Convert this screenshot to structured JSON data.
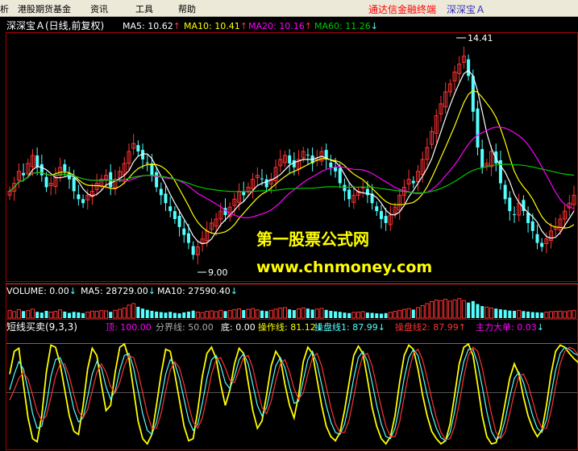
{
  "menubar": {
    "items": [
      "析",
      "港股期货基金",
      "资讯",
      "工具",
      "帮助"
    ],
    "app_title": "通达信金融终端",
    "security_title": "深深宝Ａ"
  },
  "colors": {
    "up": "#ff3232",
    "down": "#54ffff",
    "ma5": "#ffffff",
    "ma10": "#ffff00",
    "ma20": "#ff00ff",
    "ma60": "#00c800",
    "panel_border": "#aa0000",
    "title_red": "#ff0000",
    "title_blue": "#3030c0",
    "watermark": "#ffff00"
  },
  "chart_data": [
    {
      "type": "candlestick",
      "title": "深深宝Ａ(日线,前复权)",
      "legend": [
        {
          "label": "MA5: 10.62",
          "arrow": "↑",
          "color": "#ffffff"
        },
        {
          "label": "MA10: 10.41",
          "arrow": "↑",
          "color": "#ffff00"
        },
        {
          "label": "MA20: 10.16",
          "arrow": "↑",
          "color": "#ff00ff"
        },
        {
          "label": "MA60: 11.26",
          "arrow": "↓",
          "color": "#00c800"
        }
      ],
      "annotations": [
        {
          "text": "14.41",
          "kind": "high"
        },
        {
          "text": "9.00",
          "kind": "low"
        }
      ],
      "ylim": [
        8.7,
        14.8
      ],
      "closes": [
        10.9,
        11.1,
        11.4,
        11.3,
        11.6,
        11.8,
        11.5,
        11.3,
        11.0,
        11.1,
        11.3,
        11.5,
        11.4,
        11.2,
        10.9,
        10.7,
        10.6,
        10.8,
        10.9,
        11.1,
        11.2,
        11.3,
        11.0,
        11.2,
        11.4,
        11.6,
        11.9,
        12.1,
        11.9,
        11.7,
        11.6,
        11.3,
        11.0,
        10.8,
        10.6,
        10.4,
        10.2,
        10.0,
        9.8,
        9.6,
        9.3,
        9.5,
        9.7,
        9.9,
        10.1,
        10.2,
        10.4,
        10.3,
        10.5,
        10.7,
        10.9,
        10.8,
        11.0,
        11.2,
        11.3,
        11.2,
        11.0,
        11.2,
        11.5,
        11.7,
        11.8,
        11.6,
        11.5,
        11.7,
        11.9,
        11.8,
        11.6,
        11.7,
        11.9,
        11.7,
        11.5,
        11.4,
        11.1,
        10.9,
        10.7,
        10.8,
        10.9,
        11.0,
        10.8,
        10.6,
        10.4,
        10.2,
        10.1,
        10.3,
        10.5,
        10.8,
        11.0,
        11.2,
        11.1,
        11.4,
        11.7,
        12.0,
        12.4,
        12.8,
        13.1,
        13.4,
        13.6,
        13.9,
        14.1,
        14.3,
        13.8,
        12.9,
        12.0,
        11.5,
        11.6,
        11.9,
        11.6,
        11.1,
        10.7,
        10.4,
        10.3,
        10.6,
        10.4,
        10.1,
        9.9,
        9.6,
        9.5,
        9.7,
        9.9,
        10.0,
        10.2,
        10.4,
        10.6,
        10.8
      ]
    },
    {
      "type": "bar",
      "title": "VOLUME: 0.00",
      "legend": [
        {
          "label": "VOLUME: 0.00",
          "arrow": "↓",
          "color": "#ffffff"
        },
        {
          "label": "MA5: 28729.00",
          "arrow": "↓",
          "color": "#ffffff"
        },
        {
          "label": "MA10: 27590.40",
          "arrow": "↓",
          "color": "#ffffff"
        }
      ],
      "values": [
        31000,
        26000,
        34000,
        28000,
        30000,
        36000,
        25000,
        22000,
        29000,
        24000,
        27000,
        33000,
        26000,
        21000,
        25000,
        23000,
        20000,
        24000,
        28000,
        27000,
        30000,
        29000,
        25000,
        31000,
        35000,
        40000,
        52000,
        58000,
        45000,
        38000,
        33000,
        29000,
        26000,
        24000,
        22000,
        25000,
        21000,
        19000,
        23000,
        26000,
        30000,
        24000,
        22000,
        27000,
        29000,
        26000,
        31000,
        28000,
        30000,
        34000,
        37000,
        32000,
        35000,
        38000,
        33000,
        30000,
        28000,
        31000,
        36000,
        40000,
        42000,
        35000,
        32000,
        37000,
        41000,
        38000,
        34000,
        36000,
        39000,
        33000,
        29000,
        27000,
        25000,
        22000,
        20000,
        23000,
        24000,
        26000,
        22000,
        21000,
        19000,
        18000,
        20000,
        23000,
        27000,
        31000,
        35000,
        38000,
        34000,
        42000,
        50000,
        58000,
        66000,
        72000,
        70000,
        75000,
        68000,
        73000,
        78000,
        70000,
        62000,
        68000,
        56000,
        48000,
        44000,
        40000,
        38000,
        35000,
        33000,
        30000,
        29000,
        31000,
        28000,
        26000,
        24000,
        23000,
        22000,
        24000,
        26000,
        27000,
        28000,
        26000,
        29000,
        31000
      ],
      "ylim": [
        0,
        90000
      ]
    },
    {
      "type": "line",
      "title": "短线买卖(9,3,3)",
      "legend": [
        {
          "label": "短线买卖(9,3,3)",
          "arrow": "",
          "color": "#ffffff"
        },
        {
          "label": "顶: 100.00",
          "arrow": "",
          "color": "#ff00ff"
        },
        {
          "label": "分界线: 50.00",
          "arrow": "",
          "color": "#aaaaaa"
        },
        {
          "label": "底: 0.00",
          "arrow": "",
          "color": "#ffffff"
        },
        {
          "label": "操作线: 81.12",
          "arrow": "↓",
          "color": "#ffff00"
        },
        {
          "label": "操盘线1: 87.99",
          "arrow": "↓",
          "color": "#54ffff"
        },
        {
          "label": "操盘线2: 87.99",
          "arrow": "↑",
          "color": "#ff3232"
        },
        {
          "label": "主力大单: 0.03",
          "arrow": "↓",
          "color": "#ff00ff"
        }
      ],
      "levels": {
        "top": 100,
        "mid": 50,
        "bottom": 0
      },
      "ylim": [
        0,
        110
      ],
      "series": [
        {
          "name": "操作线",
          "color": "#ffff00",
          "values": [
            70,
            92,
            95,
            60,
            28,
            8,
            5,
            30,
            72,
            98,
            96,
            80,
            55,
            30,
            15,
            12,
            40,
            75,
            95,
            88,
            60,
            35,
            40,
            72,
            96,
            99,
            85,
            55,
            25,
            8,
            3,
            12,
            40,
            70,
            94,
            92,
            70,
            45,
            20,
            6,
            8,
            35,
            68,
            90,
            96,
            85,
            60,
            40,
            55,
            80,
            95,
            90,
            62,
            35,
            18,
            25,
            50,
            78,
            92,
            85,
            60,
            40,
            28,
            50,
            82,
            96,
            90,
            65,
            40,
            20,
            10,
            6,
            14,
            35,
            62,
            88,
            97,
            90,
            65,
            38,
            20,
            8,
            3,
            10,
            30,
            62,
            88,
            98,
            94,
            75,
            50,
            30,
            15,
            8,
            3,
            6,
            22,
            50,
            80,
            96,
            99,
            88,
            60,
            30,
            10,
            3,
            4,
            18,
            42,
            66,
            80,
            70,
            48,
            30,
            18,
            10,
            16,
            40,
            70,
            92,
            98,
            96,
            90,
            85,
            81
          ]
        },
        {
          "name": "操盘线1",
          "color": "#54ffff",
          "values": [
            55,
            70,
            82,
            75,
            55,
            32,
            18,
            20,
            40,
            68,
            84,
            86,
            75,
            56,
            36,
            24,
            28,
            48,
            70,
            82,
            76,
            58,
            46,
            54,
            74,
            88,
            90,
            76,
            54,
            32,
            16,
            12,
            24,
            46,
            70,
            84,
            80,
            66,
            46,
            26,
            16,
            22,
            42,
            66,
            84,
            88,
            78,
            62,
            56,
            68,
            84,
            90,
            80,
            60,
            40,
            30,
            38,
            58,
            78,
            86,
            76,
            58,
            42,
            44,
            64,
            84,
            92,
            80,
            60,
            40,
            24,
            14,
            12,
            22,
            42,
            66,
            86,
            92,
            82,
            62,
            40,
            22,
            10,
            8,
            18,
            40,
            66,
            86,
            94,
            88,
            70,
            50,
            32,
            18,
            9,
            6,
            14,
            34,
            60,
            82,
            94,
            94,
            80,
            58,
            34,
            15,
            7,
            10,
            26,
            48,
            66,
            72,
            62,
            46,
            30,
            18,
            14,
            26,
            50,
            74,
            90,
            96,
            94,
            90,
            88
          ]
        },
        {
          "name": "操盘线2",
          "color": "#ff3232",
          "values": [
            45,
            55,
            66,
            72,
            65,
            50,
            34,
            25,
            30,
            48,
            68,
            80,
            80,
            68,
            50,
            34,
            28,
            36,
            54,
            72,
            80,
            72,
            58,
            52,
            62,
            78,
            88,
            86,
            72,
            52,
            32,
            18,
            18,
            32,
            54,
            74,
            82,
            76,
            60,
            40,
            24,
            18,
            28,
            48,
            70,
            84,
            86,
            76,
            64,
            62,
            74,
            86,
            88,
            76,
            56,
            38,
            32,
            44,
            64,
            80,
            84,
            72,
            56,
            46,
            52,
            70,
            86,
            90,
            78,
            58,
            38,
            22,
            14,
            14,
            26,
            48,
            72,
            88,
            90,
            78,
            58,
            38,
            20,
            10,
            10,
            24,
            48,
            72,
            90,
            94,
            84,
            66,
            46,
            28,
            14,
            7,
            8,
            20,
            42,
            68,
            88,
            96,
            92,
            76,
            54,
            32,
            14,
            8,
            14,
            32,
            52,
            68,
            70,
            60,
            44,
            28,
            18,
            18,
            34,
            58,
            80,
            92,
            96,
            94,
            88
          ]
        },
        {
          "name": "主力大单",
          "color": "#ff00ff",
          "values": [
            0,
            0,
            0,
            0,
            0,
            0,
            0,
            0,
            0,
            0,
            0,
            0,
            0,
            0,
            0,
            0,
            0,
            0,
            0,
            0,
            0,
            0,
            0,
            0,
            0,
            0,
            0,
            0,
            0,
            0,
            0,
            0,
            0,
            0,
            0,
            0,
            0,
            0,
            0,
            0,
            0,
            0,
            0,
            0,
            0,
            0,
            0,
            0,
            0,
            0,
            0,
            0,
            0,
            0,
            0,
            0,
            0,
            0,
            0,
            0,
            0,
            0,
            0,
            0,
            0,
            0,
            0,
            0,
            0,
            0,
            0,
            0,
            0,
            0,
            0,
            0,
            0,
            0,
            0,
            0,
            0,
            0,
            0,
            0,
            0,
            0,
            0,
            0,
            0,
            0,
            0,
            0,
            0,
            0,
            0,
            0,
            0,
            0,
            0,
            0,
            0,
            0,
            0,
            0,
            0,
            0,
            0,
            0,
            0,
            0,
            0,
            0,
            0,
            0,
            0,
            0,
            0,
            0,
            0,
            0,
            0,
            0,
            0,
            0,
            0
          ]
        }
      ]
    }
  ],
  "watermark": {
    "line1": "第一股票公式网",
    "line2": "www.chnmoney.com"
  }
}
